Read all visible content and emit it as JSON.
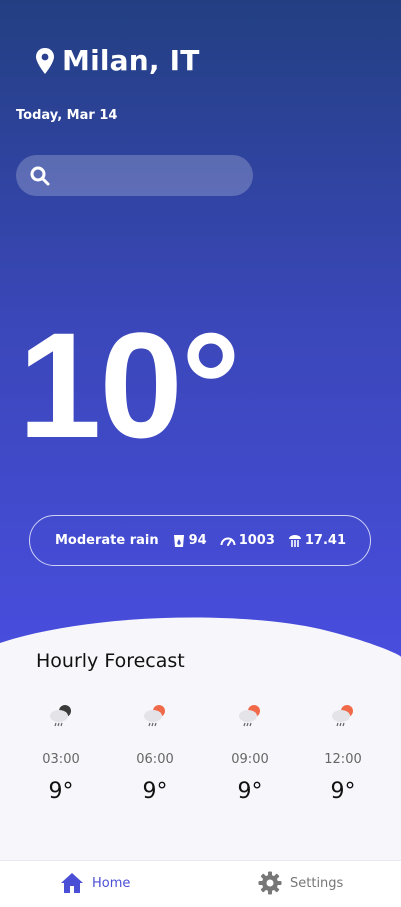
{
  "location": {
    "city": "Milan, IT"
  },
  "date_label": "Today, Mar 14",
  "search": {
    "placeholder": ""
  },
  "current": {
    "temperature": "10°",
    "condition": "Moderate rain",
    "humidity": "94",
    "pressure": "1003",
    "wind": "17.41"
  },
  "hourly": {
    "title": "Hourly Forecast",
    "items": [
      {
        "time": "03:00",
        "temp": "9°",
        "icon": "night-rain-icon"
      },
      {
        "time": "06:00",
        "temp": "9°",
        "icon": "day-rain-icon"
      },
      {
        "time": "09:00",
        "temp": "9°",
        "icon": "day-rain-icon"
      },
      {
        "time": "12:00",
        "temp": "9°",
        "icon": "day-rain-icon"
      }
    ]
  },
  "nav": {
    "home_label": "Home",
    "settings_label": "Settings"
  },
  "colors": {
    "gradient_top": "#233f82",
    "gradient_bottom": "#4a4ee2",
    "nav_active": "#4b4fd6",
    "nav_inactive": "#777777",
    "sun": "#f06a4a"
  }
}
